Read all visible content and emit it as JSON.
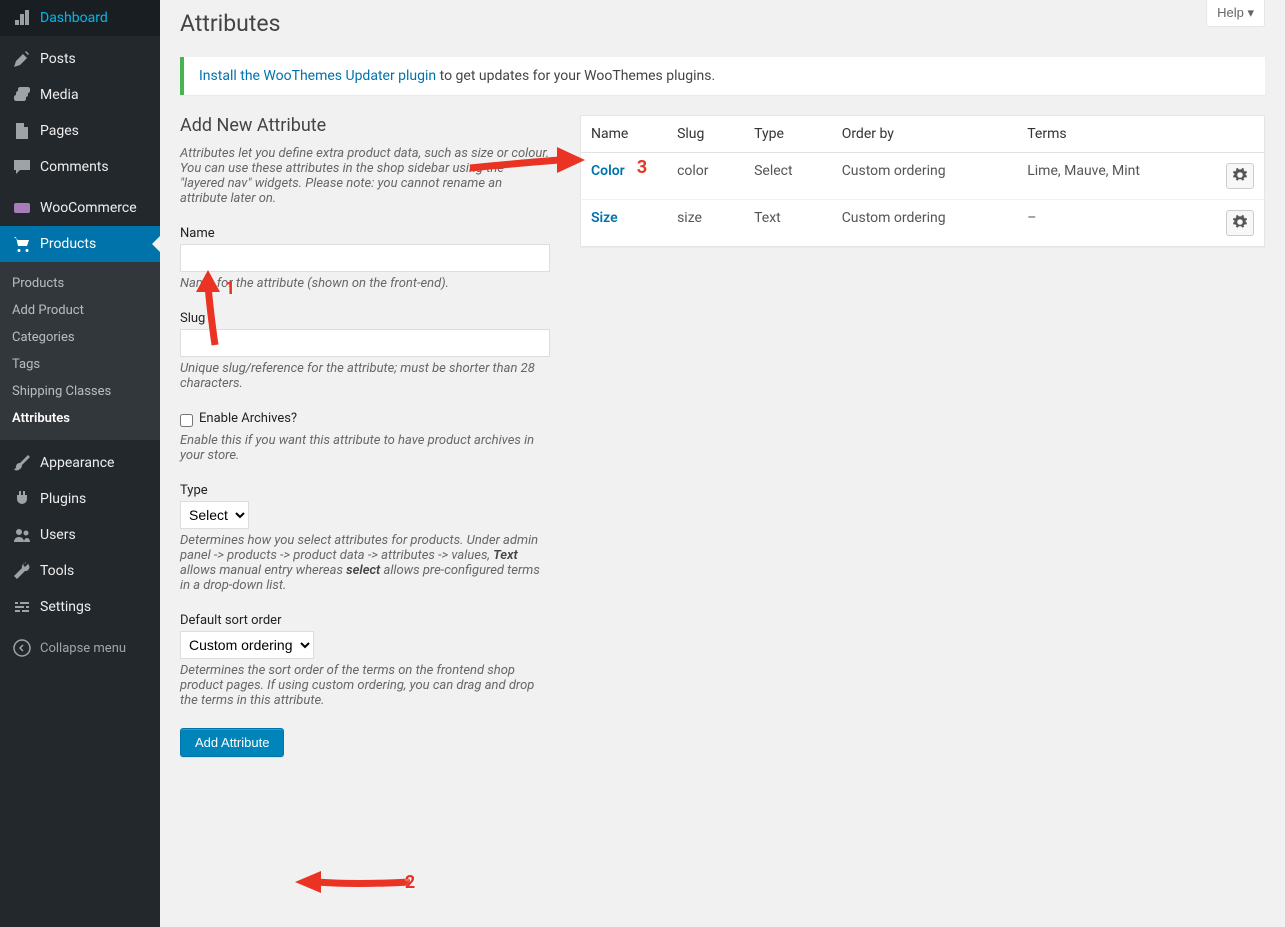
{
  "sidebar": {
    "items": [
      {
        "icon": "dashboard",
        "label": "Dashboard"
      },
      {
        "icon": "post",
        "label": "Posts"
      },
      {
        "icon": "media",
        "label": "Media"
      },
      {
        "icon": "page",
        "label": "Pages"
      },
      {
        "icon": "comment",
        "label": "Comments"
      },
      {
        "icon": "woo",
        "label": "WooCommerce"
      },
      {
        "icon": "cart",
        "label": "Products"
      },
      {
        "icon": "brush",
        "label": "Appearance"
      },
      {
        "icon": "plugin",
        "label": "Plugins"
      },
      {
        "icon": "users",
        "label": "Users"
      },
      {
        "icon": "wrench",
        "label": "Tools"
      },
      {
        "icon": "sliders",
        "label": "Settings"
      }
    ],
    "submenu": [
      "Products",
      "Add Product",
      "Categories",
      "Tags",
      "Shipping Classes",
      "Attributes"
    ],
    "collapse": "Collapse menu"
  },
  "help_tab": "Help",
  "page_title": "Attributes",
  "notice": {
    "link": "Install the WooThemes Updater plugin",
    "rest": " to get updates for your WooThemes plugins."
  },
  "form": {
    "heading": "Add New Attribute",
    "intro": "Attributes let you define extra product data, such as size or colour. You can use these attributes in the shop sidebar using the \"layered nav\" widgets. Please note: you cannot rename an attribute later on.",
    "name_label": "Name",
    "name_desc": "Name for the attribute (shown on the front-end).",
    "slug_label": "Slug",
    "slug_desc": "Unique slug/reference for the attribute; must be shorter than 28 characters.",
    "archives_label": "Enable Archives?",
    "archives_desc": "Enable this if you want this attribute to have product archives in your store.",
    "type_label": "Type",
    "type_option": "Select",
    "type_desc_1": "Determines how you select attributes for products. Under admin panel -> products -> product data -> attributes -> values, ",
    "type_desc_text": "Text",
    "type_desc_2": " allows manual entry whereas ",
    "type_desc_select": "select",
    "type_desc_3": " allows pre-configured terms in a drop-down list.",
    "sort_label": "Default sort order",
    "sort_option": "Custom ordering",
    "sort_desc": "Determines the sort order of the terms on the frontend shop product pages. If using custom ordering, you can drag and drop the terms in this attribute.",
    "submit": "Add Attribute"
  },
  "table": {
    "headers": [
      "Name",
      "Slug",
      "Type",
      "Order by",
      "Terms"
    ],
    "rows": [
      {
        "name": "Color",
        "slug": "color",
        "type": "Select",
        "orderby": "Custom ordering",
        "terms": "Lime, Mauve, Mint"
      },
      {
        "name": "Size",
        "slug": "size",
        "type": "Text",
        "orderby": "Custom ordering",
        "terms": "–"
      }
    ]
  },
  "annotations": {
    "one": "1",
    "two": "2",
    "three": "3"
  }
}
